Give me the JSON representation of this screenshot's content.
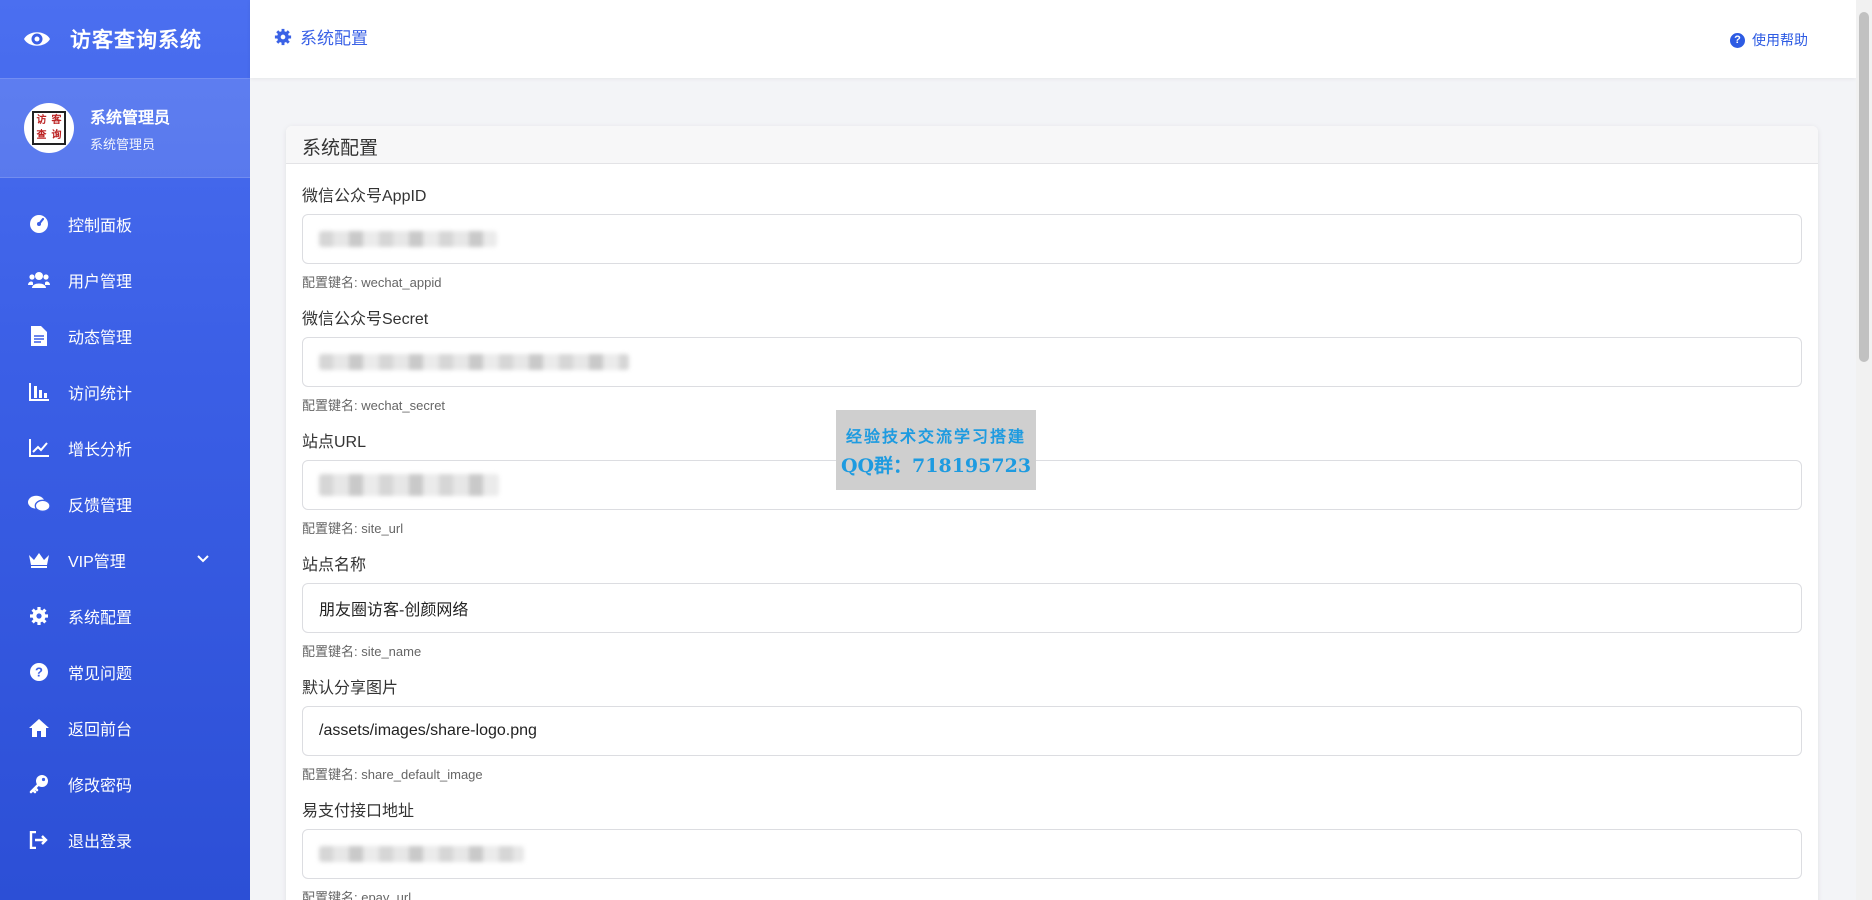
{
  "app": {
    "title": "访客查询系统"
  },
  "profile": {
    "name": "系统管理员",
    "role": "系统管理员",
    "avatar_text": [
      "访",
      "客",
      "查",
      "询"
    ]
  },
  "menu": [
    {
      "label": "控制面板",
      "icon": "dashboard-icon"
    },
    {
      "label": "用户管理",
      "icon": "users-icon"
    },
    {
      "label": "动态管理",
      "icon": "file-icon"
    },
    {
      "label": "访问统计",
      "icon": "bar-chart-icon"
    },
    {
      "label": "增长分析",
      "icon": "line-chart-icon"
    },
    {
      "label": "反馈管理",
      "icon": "comments-icon"
    },
    {
      "label": "VIP管理",
      "icon": "crown-icon",
      "has_submenu": true
    },
    {
      "label": "系统配置",
      "icon": "gear-icon"
    },
    {
      "label": "常见问题",
      "icon": "question-icon"
    },
    {
      "label": "返回前台",
      "icon": "home-icon"
    },
    {
      "label": "修改密码",
      "icon": "key-icon"
    },
    {
      "label": "退出登录",
      "icon": "logout-icon"
    }
  ],
  "header": {
    "page_title": "系统配置",
    "help_label": "使用帮助"
  },
  "card": {
    "title": "系统配置"
  },
  "fields": [
    {
      "label": "微信公众号AppID",
      "value": "",
      "redacted": true,
      "hint": "配置键名: wechat_appid"
    },
    {
      "label": "微信公众号Secret",
      "value": "",
      "redacted": true,
      "hint": "配置键名: wechat_secret"
    },
    {
      "label": "站点URL",
      "value": "",
      "redacted": true,
      "hint": "配置键名: site_url"
    },
    {
      "label": "站点名称",
      "value": "朋友圈访客-创颜网络",
      "redacted": false,
      "hint": "配置键名: site_name"
    },
    {
      "label": "默认分享图片",
      "value": "/assets/images/share-logo.png",
      "redacted": false,
      "hint": "配置键名: share_default_image"
    },
    {
      "label": "易支付接口地址",
      "value": "",
      "redacted": true,
      "hint": "配置键名: epay_url"
    }
  ],
  "watermark": {
    "line1": "经验技术交流学习搭建",
    "line2": "QQ群：718195723"
  },
  "colors": {
    "sidebar": "#3b5fe6",
    "accent": "#3b62e6",
    "watermark_text": "#1e9be0"
  }
}
